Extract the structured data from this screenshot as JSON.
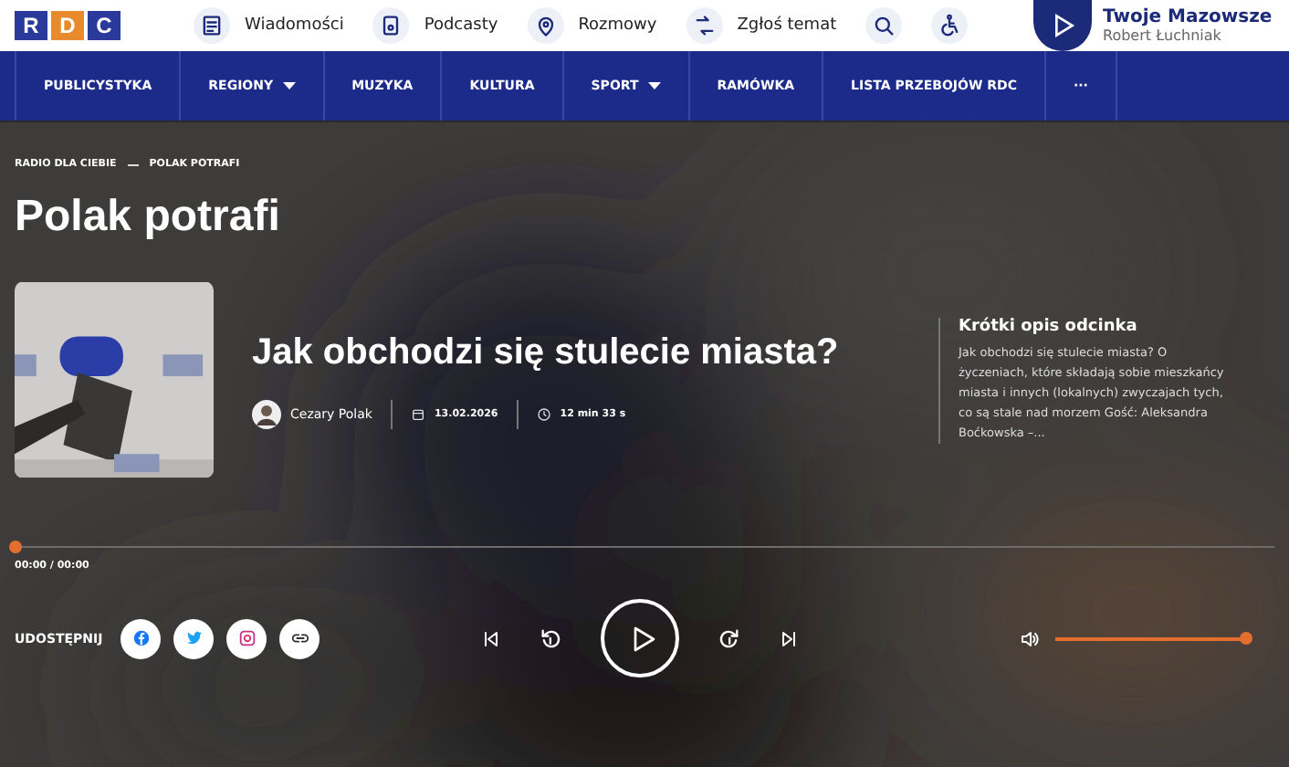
{
  "header": {
    "logo": [
      "R",
      "D",
      "C"
    ],
    "links": [
      {
        "label": "Wiadomości"
      },
      {
        "label": "Podcasty"
      },
      {
        "label": "Rozmowy"
      },
      {
        "label": "Zgłoś temat"
      }
    ],
    "live": {
      "title": "Twoje Mazowsze",
      "host": "Robert Łuchniak"
    }
  },
  "nav": [
    {
      "label": "PUBLICYSTYKA",
      "dropdown": false
    },
    {
      "label": "REGIONY",
      "dropdown": true
    },
    {
      "label": "MUZYKA",
      "dropdown": false
    },
    {
      "label": "KULTURA",
      "dropdown": false
    },
    {
      "label": "SPORT",
      "dropdown": true
    },
    {
      "label": "RAMÓWKA",
      "dropdown": false
    },
    {
      "label": "LISTA PRZEBOJÓW RDC",
      "dropdown": false
    },
    {
      "label": "···",
      "dropdown": false
    }
  ],
  "breadcrumb": [
    "RADIO DLA CIEBIE",
    "POLAK POTRAFI"
  ],
  "page_title": "Polak potrafi",
  "episode": {
    "title": "Jak obchodzi się stulecie miasta?",
    "author": "Cezary Polak",
    "date": "13.02.2026",
    "duration": "12 min 33 s",
    "summary_title": "Krótki opis odcinka",
    "summary": "Jak obchodzi się stulecie miasta? O życzeniach, które składają sobie mieszkańcy miasta i innych (lokalnych) zwyczajach tych, co są stale nad morzem Gość: Aleksandra Boćkowska –..."
  },
  "player": {
    "level": 0,
    "time": "00:00 / 00:00",
    "share_label": "UDOSTĘPNIJ",
    "volume": {
      "level": 1
    }
  }
}
